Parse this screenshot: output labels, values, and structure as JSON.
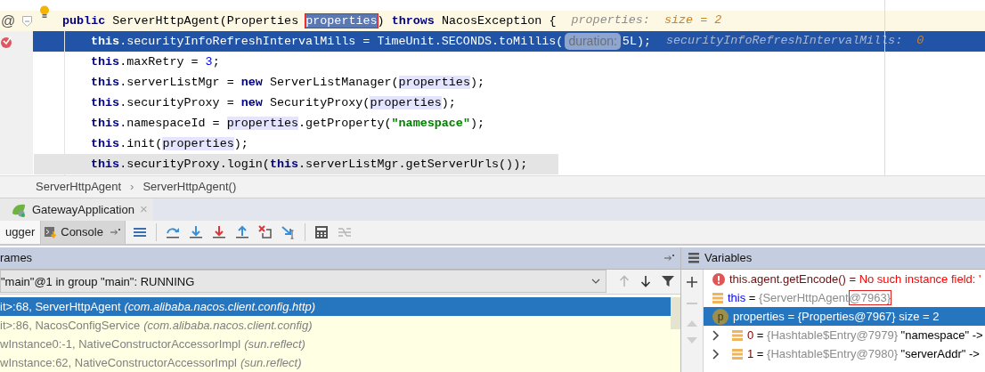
{
  "editor": {
    "lines": [
      {
        "kind": "caret",
        "gutter_mark": "@",
        "breakpoint": false,
        "segments": [
          {
            "kind": "code",
            "tokens": [
              {
                "text": "public",
                "kind": "keyword"
              },
              {
                "text": " ServerHttpAgent(Properties ",
                "kind": "plain"
              },
              {
                "text": "properties",
                "kind": "selection",
                "annotated": true
              },
              {
                "text": ") ",
                "kind": "plain"
              },
              {
                "text": "throws",
                "kind": "keyword"
              },
              {
                "text": " NacosException {",
                "kind": "plain"
              }
            ]
          },
          {
            "kind": "inline_hint",
            "label": "properties:",
            "value": "size = 2"
          }
        ],
        "children": [
          {
            "kind": "execution",
            "breakpoint": true,
            "segments": [
              {
                "kind": "code",
                "tokens": [
                  {
                    "text": "this",
                    "kind": "keyword"
                  },
                  {
                    "text": ".securityInfoRefreshIntervalMills = TimeUnit.SECONDS.toMillis(",
                    "kind": "plain"
                  }
                ]
              },
              {
                "kind": "param_hint",
                "text": "duration:"
              },
              {
                "kind": "code",
                "tokens": [
                  {
                    "text": "5L);",
                    "kind": "plain"
                  }
                ]
              },
              {
                "kind": "inline_hint",
                "label": "securityInfoRefreshIntervalMills:",
                "value": "0"
              }
            ]
          },
          {
            "kind": "normal",
            "breakpoint": false,
            "segments": [
              {
                "kind": "code",
                "tokens": [
                  {
                    "text": "this",
                    "kind": "keyword"
                  },
                  {
                    "text": ".maxRetry = ",
                    "kind": "plain"
                  },
                  {
                    "text": "3",
                    "kind": "number"
                  },
                  {
                    "text": ";",
                    "kind": "plain"
                  }
                ]
              }
            ]
          },
          {
            "kind": "normal",
            "breakpoint": false,
            "segments": [
              {
                "kind": "code",
                "tokens": [
                  {
                    "text": "this",
                    "kind": "keyword"
                  },
                  {
                    "text": ".serverListMgr = ",
                    "kind": "plain"
                  },
                  {
                    "text": "new",
                    "kind": "keyword"
                  },
                  {
                    "text": " ServerListManager(",
                    "kind": "plain"
                  },
                  {
                    "text": "properties",
                    "kind": "usage"
                  },
                  {
                    "text": ");",
                    "kind": "plain"
                  }
                ]
              }
            ]
          },
          {
            "kind": "normal",
            "breakpoint": false,
            "segments": [
              {
                "kind": "code",
                "tokens": [
                  {
                    "text": "this",
                    "kind": "keyword"
                  },
                  {
                    "text": ".securityProxy = ",
                    "kind": "plain"
                  },
                  {
                    "text": "new",
                    "kind": "keyword"
                  },
                  {
                    "text": " SecurityProxy(",
                    "kind": "plain"
                  },
                  {
                    "text": "properties",
                    "kind": "usage"
                  },
                  {
                    "text": ");",
                    "kind": "plain"
                  }
                ]
              }
            ]
          },
          {
            "kind": "normal",
            "breakpoint": false,
            "segments": [
              {
                "kind": "code",
                "tokens": [
                  {
                    "text": "this",
                    "kind": "keyword"
                  },
                  {
                    "text": ".namespaceId = ",
                    "kind": "plain"
                  },
                  {
                    "text": "properties",
                    "kind": "usage"
                  },
                  {
                    "text": ".getProperty(",
                    "kind": "plain"
                  },
                  {
                    "text": "\"namespace\"",
                    "kind": "string"
                  },
                  {
                    "text": ");",
                    "kind": "plain"
                  }
                ]
              }
            ]
          },
          {
            "kind": "normal",
            "breakpoint": false,
            "segments": [
              {
                "kind": "code",
                "tokens": [
                  {
                    "text": "this",
                    "kind": "keyword"
                  },
                  {
                    "text": ".init(",
                    "kind": "plain"
                  },
                  {
                    "text": "properties",
                    "kind": "usage"
                  },
                  {
                    "text": ");",
                    "kind": "plain"
                  }
                ]
              }
            ]
          },
          {
            "kind": "shaded",
            "breakpoint": false,
            "segments": [
              {
                "kind": "code",
                "tokens": [
                  {
                    "text": "this",
                    "kind": "keyword"
                  },
                  {
                    "text": ".securityProxy.login(",
                    "kind": "plain"
                  },
                  {
                    "text": "this",
                    "kind": "keyword"
                  },
                  {
                    "text": ".serverListMgr.getServerUrls());",
                    "kind": "plain"
                  }
                ]
              }
            ]
          }
        ]
      }
    ]
  },
  "breadcrumbs": [
    "ServerHttpAgent",
    "ServerHttpAgent()"
  ],
  "breadcrumb_separator": "›",
  "run_tab": {
    "label": "GatewayApplication",
    "close": "×"
  },
  "debug_tabs": [
    {
      "label": "ugger",
      "selected": true
    },
    {
      "label": "Console",
      "selected": false
    }
  ],
  "frames": {
    "title": "rames",
    "thread": "\"main\"@1 in group \"main\": RUNNING",
    "rows": [
      {
        "method": "it>:68, ServerHttpAgent",
        "package": "(com.alibaba.nacos.client.config.http)",
        "selected": true
      },
      {
        "method": "it>:86, NacosConfigService",
        "package": "(com.alibaba.nacos.client.config)",
        "selected": false
      },
      {
        "method": "wInstance0:-1, NativeConstructorAccessorImpl",
        "package": "(sun.reflect)",
        "selected": false
      },
      {
        "method": "wInstance:62, NativeConstructorAccessorImpl",
        "package": "(sun.reflect)",
        "selected": false
      }
    ]
  },
  "variables": {
    "title": "Variables",
    "rows": [
      {
        "kind": "error",
        "expression": "this.agent.getEncode()",
        "operator": "=",
        "message": "No such instance field: '",
        "selected": false
      },
      {
        "kind": "field",
        "name": "this",
        "operator": "=",
        "value": "{ServerHttpAgent",
        "value_end": "@7963}",
        "annotated": true,
        "selected": false
      },
      {
        "kind": "param",
        "icon_letter": "p",
        "name": "properties",
        "operator": "=",
        "value": "{Properties@7967}",
        "extra": "size = 2",
        "selected": true,
        "children": [
          {
            "kind": "field",
            "name": "0",
            "operator": "=",
            "value": "{Hashtable$Entry@7979}",
            "extra": "\"namespace\" ->",
            "expanded": false,
            "selected": false
          },
          {
            "kind": "field",
            "name": "1",
            "operator": "=",
            "value": "{Hashtable$Entry@7980}",
            "extra": "\"serverAddr\" ->",
            "expanded": false,
            "selected": false
          }
        ]
      }
    ]
  }
}
